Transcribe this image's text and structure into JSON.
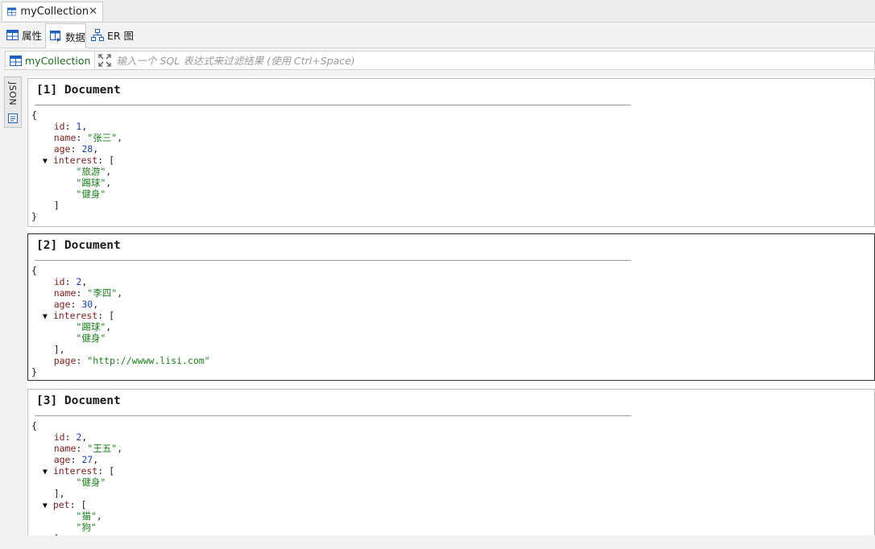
{
  "editor_tab": {
    "title": "myCollection"
  },
  "subtabs": [
    {
      "label": "属性",
      "icon": "table-icon"
    },
    {
      "label": "数据",
      "icon": "data-grid-icon"
    },
    {
      "label": "ER 图",
      "icon": "er-diagram-icon"
    }
  ],
  "filter": {
    "collection": "myCollection",
    "placeholder": "输入一个 SQL 表达式来过滤结果 (使用 Ctrl+Space)"
  },
  "side_tab": {
    "label": "JSON"
  },
  "colors": {
    "key": "#7f1d1d",
    "number": "#1a3fb8",
    "string": "#1a7f1a",
    "accent": "#1f5fbf"
  },
  "documents": [
    {
      "title": "[1] Document",
      "selected": false,
      "lines": [
        [
          {
            "t": "{",
            "c": "p"
          }
        ],
        [
          {
            "t": "    "
          },
          {
            "t": "id",
            "c": "k"
          },
          {
            "t": ": ",
            "c": "p"
          },
          {
            "t": "1",
            "c": "n"
          },
          {
            "t": ",",
            "c": "p"
          }
        ],
        [
          {
            "t": "    "
          },
          {
            "t": "name",
            "c": "k"
          },
          {
            "t": ": ",
            "c": "p"
          },
          {
            "t": "\"张三\"",
            "c": "s"
          },
          {
            "t": ",",
            "c": "p"
          }
        ],
        [
          {
            "t": "    "
          },
          {
            "t": "age",
            "c": "k"
          },
          {
            "t": ": ",
            "c": "p"
          },
          {
            "t": "28",
            "c": "n"
          },
          {
            "t": ",",
            "c": "p"
          }
        ],
        [
          {
            "t": "  "
          },
          {
            "t": "▼",
            "c": "tri"
          },
          {
            "t": " "
          },
          {
            "t": "interest",
            "c": "k"
          },
          {
            "t": ": [",
            "c": "p"
          }
        ],
        [
          {
            "t": "        "
          },
          {
            "t": "\"旅游\"",
            "c": "s"
          },
          {
            "t": ",",
            "c": "p"
          }
        ],
        [
          {
            "t": "        "
          },
          {
            "t": "\"踢球\"",
            "c": "s"
          },
          {
            "t": ",",
            "c": "p"
          }
        ],
        [
          {
            "t": "        "
          },
          {
            "t": "\"健身\"",
            "c": "s"
          }
        ],
        [
          {
            "t": "    "
          },
          {
            "t": "]",
            "c": "p"
          }
        ],
        [
          {
            "t": "}",
            "c": "p"
          }
        ]
      ]
    },
    {
      "title": "[2] Document",
      "selected": true,
      "lines": [
        [
          {
            "t": "{",
            "c": "p"
          }
        ],
        [
          {
            "t": "    "
          },
          {
            "t": "id",
            "c": "k"
          },
          {
            "t": ": ",
            "c": "p"
          },
          {
            "t": "2",
            "c": "n"
          },
          {
            "t": ",",
            "c": "p"
          }
        ],
        [
          {
            "t": "    "
          },
          {
            "t": "name",
            "c": "k"
          },
          {
            "t": ": ",
            "c": "p"
          },
          {
            "t": "\"李四\"",
            "c": "s"
          },
          {
            "t": ",",
            "c": "p"
          }
        ],
        [
          {
            "t": "    "
          },
          {
            "t": "age",
            "c": "k"
          },
          {
            "t": ": ",
            "c": "p"
          },
          {
            "t": "30",
            "c": "n"
          },
          {
            "t": ",",
            "c": "p"
          }
        ],
        [
          {
            "t": "  "
          },
          {
            "t": "▼",
            "c": "tri"
          },
          {
            "t": " "
          },
          {
            "t": "interest",
            "c": "k"
          },
          {
            "t": ": [",
            "c": "p"
          }
        ],
        [
          {
            "t": "        "
          },
          {
            "t": "\"踢球\"",
            "c": "s"
          },
          {
            "t": ",",
            "c": "p"
          }
        ],
        [
          {
            "t": "        "
          },
          {
            "t": "\"健身\"",
            "c": "s"
          }
        ],
        [
          {
            "t": "    "
          },
          {
            "t": "],",
            "c": "p"
          }
        ],
        [
          {
            "t": "    "
          },
          {
            "t": "page",
            "c": "k"
          },
          {
            "t": ": ",
            "c": "p"
          },
          {
            "t": "\"http://wwww.lisi.com\"",
            "c": "s"
          }
        ],
        [
          {
            "t": "}",
            "c": "p"
          }
        ]
      ]
    },
    {
      "title": "[3] Document",
      "selected": false,
      "lines": [
        [
          {
            "t": "{",
            "c": "p"
          }
        ],
        [
          {
            "t": "    "
          },
          {
            "t": "id",
            "c": "k"
          },
          {
            "t": ": ",
            "c": "p"
          },
          {
            "t": "2",
            "c": "n"
          },
          {
            "t": ",",
            "c": "p"
          }
        ],
        [
          {
            "t": "    "
          },
          {
            "t": "name",
            "c": "k"
          },
          {
            "t": ": ",
            "c": "p"
          },
          {
            "t": "\"王五\"",
            "c": "s"
          },
          {
            "t": ",",
            "c": "p"
          }
        ],
        [
          {
            "t": "    "
          },
          {
            "t": "age",
            "c": "k"
          },
          {
            "t": ": ",
            "c": "p"
          },
          {
            "t": "27",
            "c": "n"
          },
          {
            "t": ",",
            "c": "p"
          }
        ],
        [
          {
            "t": "  "
          },
          {
            "t": "▼",
            "c": "tri"
          },
          {
            "t": " "
          },
          {
            "t": "interest",
            "c": "k"
          },
          {
            "t": ": [",
            "c": "p"
          }
        ],
        [
          {
            "t": "        "
          },
          {
            "t": "\"健身\"",
            "c": "s"
          }
        ],
        [
          {
            "t": "    "
          },
          {
            "t": "],",
            "c": "p"
          }
        ],
        [
          {
            "t": "  "
          },
          {
            "t": "▼",
            "c": "tri"
          },
          {
            "t": " "
          },
          {
            "t": "pet",
            "c": "k"
          },
          {
            "t": ": [",
            "c": "p"
          }
        ],
        [
          {
            "t": "        "
          },
          {
            "t": "\"猫\"",
            "c": "s"
          },
          {
            "t": ",",
            "c": "p"
          }
        ],
        [
          {
            "t": "        "
          },
          {
            "t": "\"狗\"",
            "c": "s"
          }
        ],
        [
          {
            "t": "    "
          },
          {
            "t": "]",
            "c": "p"
          }
        ]
      ]
    }
  ]
}
